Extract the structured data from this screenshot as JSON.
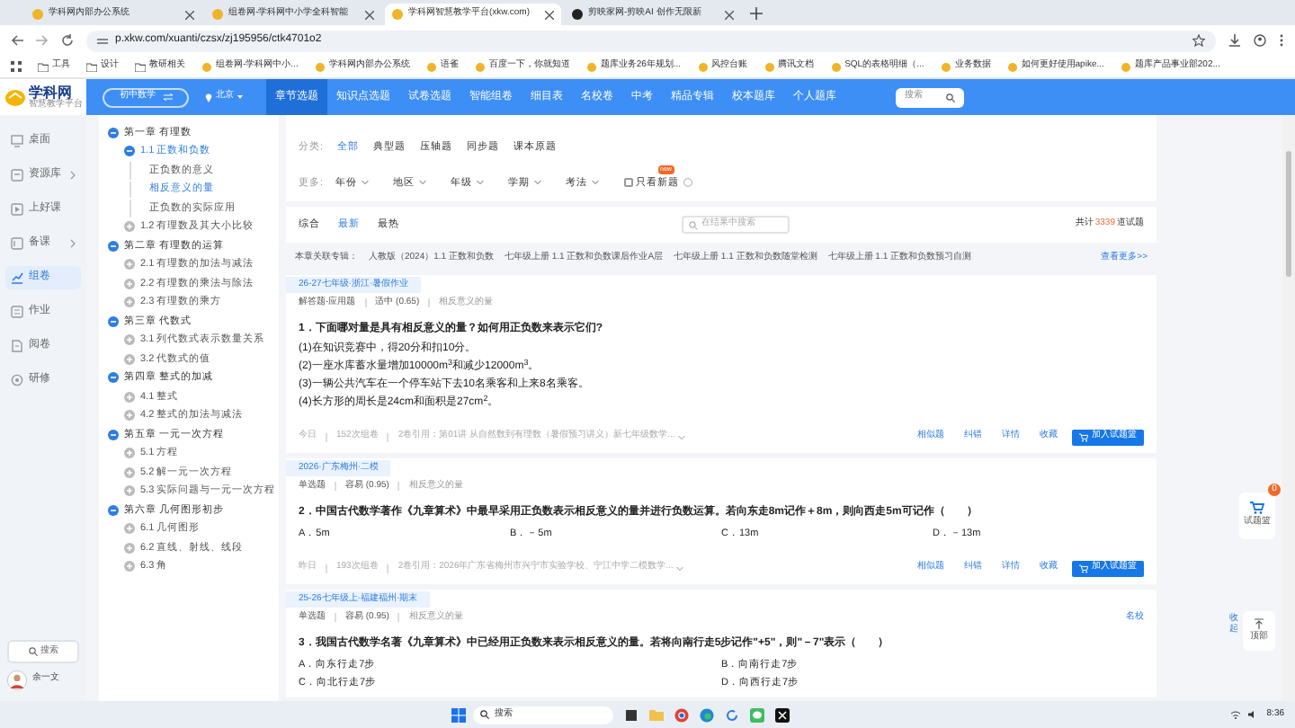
{
  "browser": {
    "tabs": [
      {
        "title": "学科网内部办公系统",
        "selected": false
      },
      {
        "title": "组卷网-学科网中小学全科智能",
        "selected": false
      },
      {
        "title": "学科网智慧教学平台(xkw.com)",
        "selected": true
      },
      {
        "title": "剪映家网-剪映AI 创作无限新",
        "selected": false
      }
    ],
    "address": "p.xkw.com/xuanti/czsx/zj195956/ctk4701o2",
    "bookmarks": [
      "工具",
      "设计",
      "教研相关",
      "组卷网-学科网中小...",
      "学科网内部办公系统",
      "语雀",
      "百度一下，你就知道",
      "题库业务26年规划...",
      "风控台账",
      "腾讯文档",
      "SQL的表格明细（...",
      "业务数据",
      "如何更好使用apike...",
      "题库产品事业部202..."
    ]
  },
  "header": {
    "logo": "学科网",
    "logo_sub": "智慧教学平台",
    "subject": "初中数学",
    "region": "北京",
    "search": "搜索",
    "nav": [
      {
        "label": "章节选题",
        "selected": true
      },
      {
        "label": "知识点选题",
        "selected": false
      },
      {
        "label": "试卷选题",
        "selected": false
      },
      {
        "label": "智能组卷",
        "selected": false
      },
      {
        "label": "细目表",
        "selected": false
      },
      {
        "label": "名校卷",
        "selected": false
      },
      {
        "label": "中考",
        "selected": false
      },
      {
        "label": "精品专辑",
        "selected": false
      },
      {
        "label": "校本题库",
        "selected": false
      },
      {
        "label": "个人题库",
        "selected": false
      }
    ]
  },
  "sidebar": {
    "items": [
      {
        "label": "桌面",
        "selected": false,
        "expandable": false
      },
      {
        "label": "资源库",
        "selected": false,
        "expandable": true
      },
      {
        "label": "上好课",
        "selected": false,
        "expandable": false
      },
      {
        "label": "备课",
        "selected": false,
        "expandable": true
      },
      {
        "label": "组卷",
        "selected": true,
        "expandable": false
      },
      {
        "label": "作业",
        "selected": false,
        "expandable": false
      },
      {
        "label": "阅卷",
        "selected": false,
        "expandable": false
      },
      {
        "label": "研修",
        "selected": false,
        "expandable": false
      }
    ],
    "search": "搜索",
    "user": "余一文"
  },
  "tree": [
    {
      "label": "第一章 有理数",
      "expanded": true,
      "children": [
        {
          "label": "1.1 正数和负数",
          "expanded": true,
          "children": [
            {
              "label": "正负数的意义",
              "selected": false
            },
            {
              "label": "相反意义的量",
              "selected": true
            },
            {
              "label": "正负数的实际应用",
              "selected": false
            }
          ]
        },
        {
          "label": "1.2 有理数及其大小比较",
          "expanded": false
        }
      ]
    },
    {
      "label": "第二章 有理数的运算",
      "expanded": true,
      "children": [
        {
          "label": "2.1 有理数的加法与减法",
          "expanded": false
        },
        {
          "label": "2.2 有理数的乘法与除法",
          "expanded": false
        },
        {
          "label": "2.3 有理数的乘方",
          "expanded": false
        }
      ]
    },
    {
      "label": "第三章 代数式",
      "expanded": true,
      "children": [
        {
          "label": "3.1 列代数式表示数量关系",
          "expanded": false
        },
        {
          "label": "3.2 代数式的值",
          "expanded": false
        }
      ]
    },
    {
      "label": "第四章 整式的加减",
      "expanded": true,
      "children": [
        {
          "label": "4.1 整式",
          "expanded": false
        },
        {
          "label": "4.2 整式的加法与减法",
          "expanded": false
        }
      ]
    },
    {
      "label": "第五章 一元一次方程",
      "expanded": true,
      "children": [
        {
          "label": "5.1 方程",
          "expanded": false
        },
        {
          "label": "5.2 解一元一次方程",
          "expanded": false
        },
        {
          "label": "5.3 实际问题与一元一次方程",
          "expanded": false
        }
      ]
    },
    {
      "label": "第六章 几何图形初步",
      "expanded": true,
      "children": [
        {
          "label": "6.1 几何图形",
          "expanded": false
        },
        {
          "label": "6.2 直线、射线、线段",
          "expanded": false
        },
        {
          "label": "6.3 角",
          "expanded": false
        }
      ]
    }
  ],
  "filters": {
    "category_label": "分类:",
    "categories": [
      {
        "label": "全部",
        "selected": true
      },
      {
        "label": "典型题",
        "selected": false
      },
      {
        "label": "压轴题",
        "selected": false
      },
      {
        "label": "同步题",
        "selected": false
      },
      {
        "label": "课本原题",
        "selected": false
      }
    ],
    "more_label": "更多:",
    "dropdowns": [
      "年份",
      "地区",
      "年级",
      "学期",
      "考法"
    ],
    "new_only": {
      "label": "只看新题",
      "checked": false,
      "badge": "new"
    }
  },
  "results": {
    "sorts": [
      {
        "label": "综合",
        "selected": false
      },
      {
        "label": "最新",
        "selected": true
      },
      {
        "label": "最热",
        "selected": false
      }
    ],
    "search_placeholder": "在结果中搜索",
    "total_prefix": "共计",
    "total": "3339",
    "total_suffix": "道试题"
  },
  "albums": {
    "label": "本章关联专辑：",
    "items": [
      "人教版（2024）1.1 正数和负数",
      "七年级上册 1.1 正数和负数课后作业A层",
      "七年级上册 1.1 正数和负数随堂检测",
      "七年级上册 1.1 正数和负数预习自测"
    ],
    "more": "查看更多>>"
  },
  "questions": [
    {
      "source": "26-27七年级·浙江·暑假作业",
      "type": "解答题-应用题",
      "difficulty": "适中 (0.65)",
      "knowledge": "相反意义的量",
      "lines": [
        "1．下面哪对量是具有相反意义的量？如何用正负数来表示它们?",
        "(1)在知识竞赛中，得20分和扣10分。",
        "(2)一座水库蓄水量增加10000m$^{3}$和减少12000m$^{3}$。",
        "(3)一辆公共汽车在一个停车站下去10名乘客和上来8名乘客。",
        "(4)长方形的周长是24cm和面积是27cm$^{2}$。"
      ],
      "date": "今日",
      "count": "152次组卷",
      "citation": "2卷引用：第01讲 从自然数到有理数（暑假预习讲义）新七年级数学...",
      "actions": [
        "相似题",
        "纠错",
        "详情",
        "收藏"
      ],
      "basket": "加入试题篮"
    },
    {
      "source": "2026·广东梅州·二模",
      "type": "单选题",
      "difficulty": "容易 (0.95)",
      "knowledge": "相反意义的量",
      "lines": [
        "2．中国古代数学著作《九章算术》中最早采用正负数表示相反意义的量并进行负数运算。若向东走8m记作＋8m，则向西走5m可记作（　　）"
      ],
      "options": [
        "A．5m",
        "B．－5m",
        "C．13m",
        "D．－13m"
      ],
      "date": "昨日",
      "count": "193次组卷",
      "citation": "2卷引用：2026年广东省梅州市兴宁市实验学校、宁江中学二模数学...",
      "actions": [
        "相似题",
        "纠错",
        "详情",
        "收藏"
      ],
      "basket": "加入试题篮"
    },
    {
      "source": "25-26七年级上·福建福州·期末",
      "type": "单选题",
      "difficulty": "容易 (0.95)",
      "knowledge": "相反意义的量",
      "badge": "名校",
      "lines": [
        "3．我国古代数学名著《九章算术》中已经用正负数来表示相反意义的量。若将向南行走5步记作\"+5\"，则\"－7\"表示（　　）"
      ],
      "options": [
        "A．向东行走7步",
        "B．向南行走7步",
        "C．向北行走7步",
        "D．向西行走7步"
      ]
    }
  ],
  "floating": {
    "basket": "试题篮",
    "basket_count": "0",
    "collapse": "收起",
    "top": "顶部"
  },
  "taskbar": {
    "search": "搜索",
    "time": "8:36"
  }
}
